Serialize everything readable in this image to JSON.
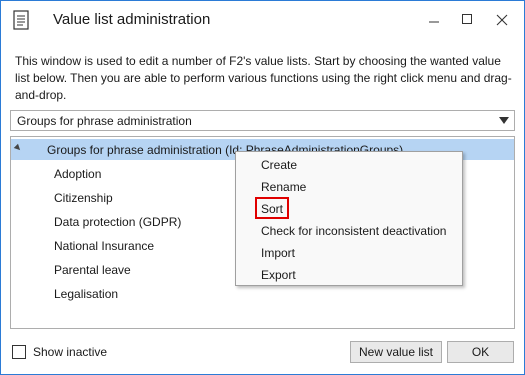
{
  "window": {
    "title": "Value list administration"
  },
  "description": "This window is used to edit a number of F2's value lists. Start by choosing the wanted value list below. Then you are able to perform various functions using the right click menu and drag-and-drop.",
  "combo": {
    "selected": "Groups for phrase administration"
  },
  "tree": {
    "root_label": "Groups for phrase administration (Id: PhraseAdministrationGroups)",
    "items": [
      {
        "label": "Adoption"
      },
      {
        "label": "Citizenship"
      },
      {
        "label": "Data protection (GDPR)"
      },
      {
        "label": "National Insurance"
      },
      {
        "label": "Parental leave"
      },
      {
        "label": "Legalisation"
      }
    ]
  },
  "context_menu": {
    "items": [
      {
        "label": "Create"
      },
      {
        "label": "Rename"
      },
      {
        "label": "Sort"
      },
      {
        "label": "Check for inconsistent deactivation"
      },
      {
        "label": "Import"
      },
      {
        "label": "Export"
      }
    ],
    "highlight_color": "#e00000"
  },
  "footer": {
    "show_inactive_label": "Show inactive",
    "show_inactive_checked": false,
    "new_value_list_label": "New value list",
    "ok_label": "OK"
  },
  "colors": {
    "selection": "#b6d4f3",
    "window_border": "#2b7bd6"
  }
}
